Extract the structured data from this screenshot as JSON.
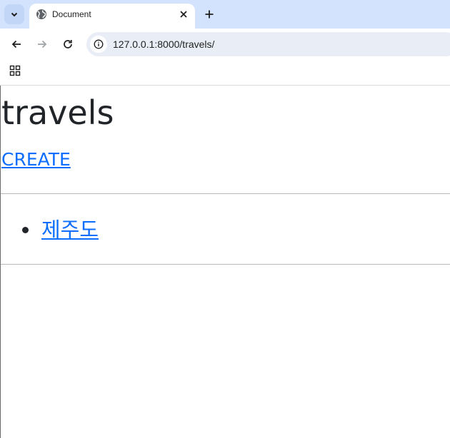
{
  "browser": {
    "tab": {
      "title": "Document",
      "favicon": "globe-icon"
    },
    "address_bar": {
      "url": "127.0.0.1:8000/travels/"
    },
    "icons": {
      "tab_search": "chevron-down-icon",
      "close": "close-icon",
      "new_tab": "plus-icon",
      "back": "back-arrow-icon",
      "forward": "forward-arrow-icon",
      "reload": "reload-icon",
      "site_info": "info-icon",
      "apps": "apps-grid-icon"
    }
  },
  "page": {
    "title": "travels",
    "create_link": "CREATE",
    "travels": [
      {
        "name": "제주도"
      }
    ]
  },
  "colors": {
    "tabstrip": "#d3e3fd",
    "link": "#0d6efd",
    "text": "#212529"
  }
}
